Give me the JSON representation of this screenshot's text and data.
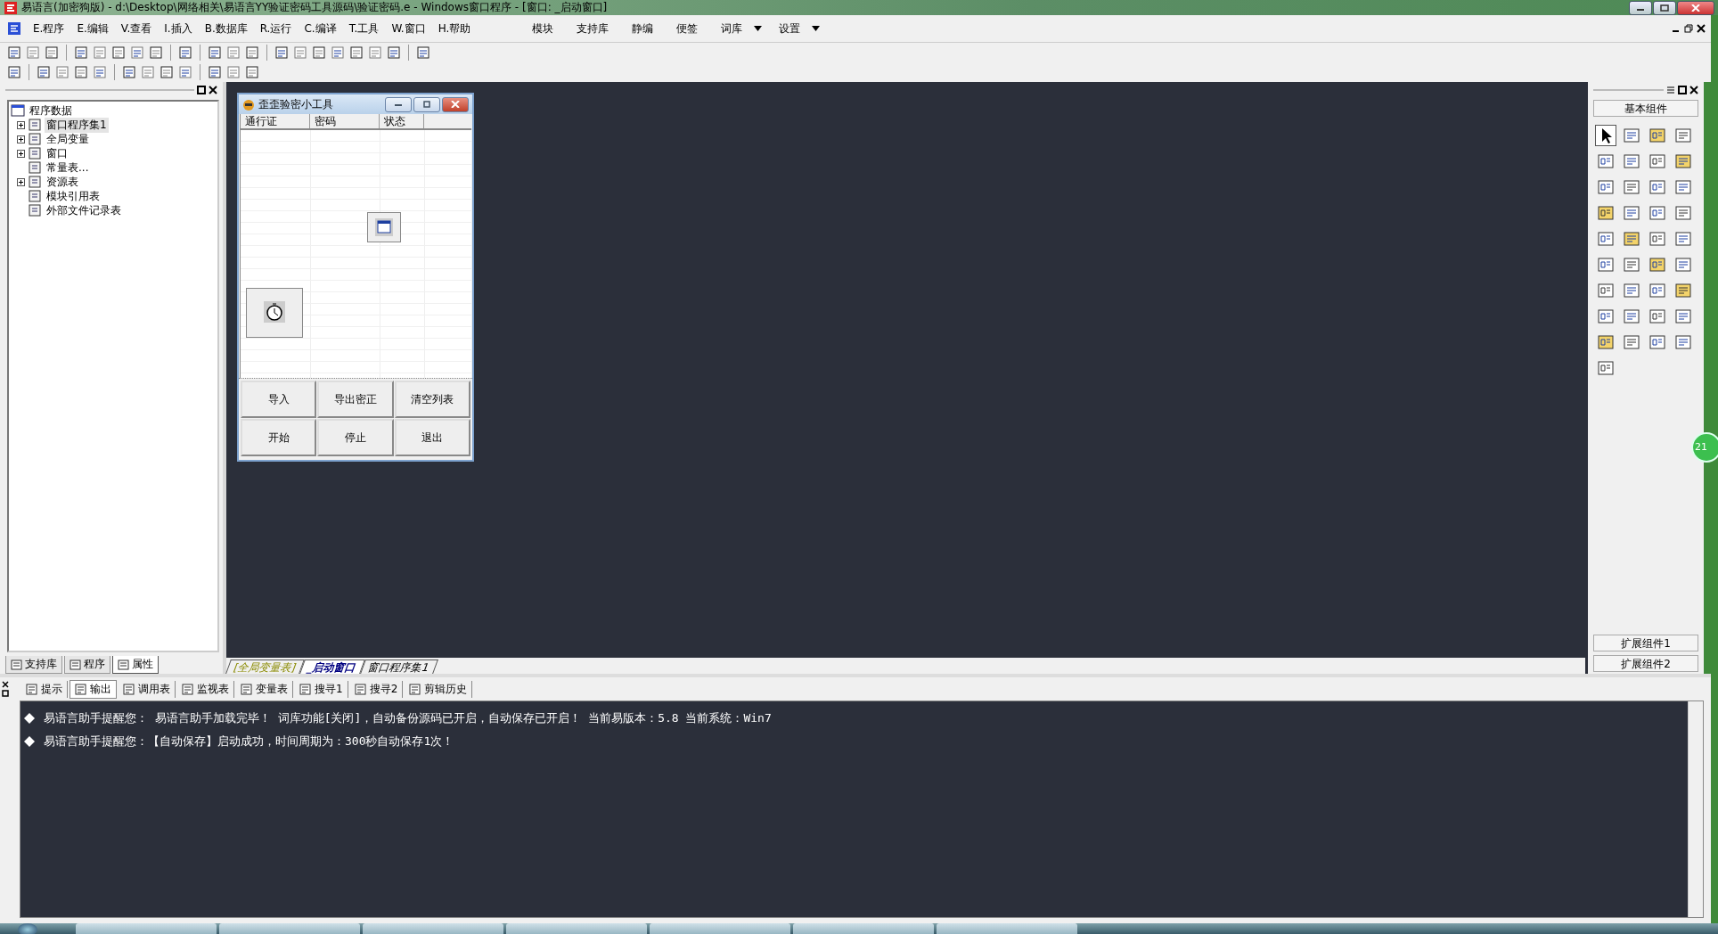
{
  "window": {
    "title": "易语言(加密狗版) - d:\\Desktop\\网络相关\\易语言YY验证密码工具源码\\验证密码.e - Windows窗口程序 - [窗口: _启动窗口]"
  },
  "menu": [
    "E.程序",
    "E.编辑",
    "V.查看",
    "I.插入",
    "B.数据库",
    "R.运行",
    "C.编译",
    "T.工具",
    "W.窗口",
    "H.帮助"
  ],
  "menu_right": [
    {
      "label": "模块",
      "dropdown": false
    },
    {
      "label": "支持库",
      "dropdown": false
    },
    {
      "label": "静编",
      "dropdown": false
    },
    {
      "label": "便签",
      "dropdown": false
    },
    {
      "label": "词库",
      "dropdown": true
    },
    {
      "label": "设置",
      "dropdown": true
    }
  ],
  "left_panel": {
    "tree": [
      {
        "label": "程序数据",
        "selected": false,
        "children": [
          {
            "label": "窗口程序集1",
            "expanded": false,
            "selected": true
          },
          {
            "label": "全局变量",
            "expanded": false,
            "selected": false
          },
          {
            "label": "窗口",
            "expanded": false,
            "selected": false
          },
          {
            "label": "常量表...",
            "selected": false
          },
          {
            "label": "资源表",
            "expanded": false,
            "selected": false
          },
          {
            "label": "模块引用表",
            "selected": false
          },
          {
            "label": "外部文件记录表",
            "selected": false
          }
        ]
      }
    ],
    "tabs": [
      {
        "label": "支持库",
        "selected": false
      },
      {
        "label": "程序",
        "selected": false
      },
      {
        "label": "属性",
        "selected": true
      }
    ]
  },
  "designer_form": {
    "title": "歪歪验密小工具",
    "columns": [
      "通行证",
      "密码",
      "状态"
    ],
    "buttons": [
      [
        "导入",
        "导出密正",
        "清空列表"
      ],
      [
        "开始",
        "停止",
        "退出"
      ]
    ]
  },
  "editor_tabs": [
    {
      "label": "[全局变量表]",
      "kind": "variables",
      "selected": false
    },
    {
      "label": "_启动窗口",
      "kind": "window",
      "selected": true
    },
    {
      "label": "窗口程序集1",
      "kind": "code",
      "selected": false
    }
  ],
  "components_panel": {
    "title": "基本组件",
    "more": [
      "扩展组件1",
      "扩展组件2"
    ]
  },
  "floating_ball": {
    "text": "21"
  },
  "output_tabs": [
    {
      "label": "提示",
      "selected": false
    },
    {
      "label": "输出",
      "selected": true
    },
    {
      "label": "调用表",
      "selected": false
    },
    {
      "label": "监视表",
      "selected": false
    },
    {
      "label": "变量表",
      "selected": false
    },
    {
      "label": "搜寻1",
      "selected": false
    },
    {
      "label": "搜寻2",
      "selected": false
    },
    {
      "label": "剪辑历史",
      "selected": false
    }
  ],
  "output_lines": [
    "易语言助手提醒您：  易语言助手加载完毕！  词库功能[关闭]，自动备份源码已开启，自动保存已开启！  当前易版本：5.8  当前系统：Win7",
    "易语言助手提醒您：【自动保存】启动成功，时间周期为：300秒自动保存1次！"
  ]
}
